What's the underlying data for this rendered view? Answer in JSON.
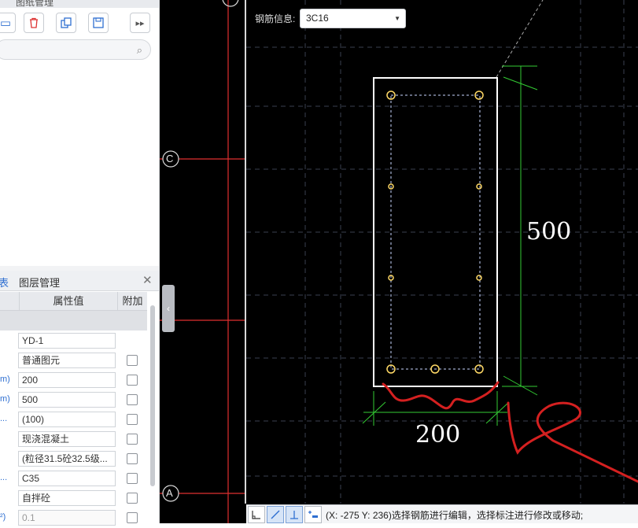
{
  "top_pane": {
    "tab_label": "图纸管理"
  },
  "toolbar": {
    "buttons": [
      {
        "name": "add-component-button",
        "icon": "monitor-icon"
      },
      {
        "name": "delete-button",
        "icon": "trash-icon"
      },
      {
        "name": "copy-button",
        "icon": "copy-icon"
      },
      {
        "name": "save-as-button",
        "icon": "save-icon"
      },
      {
        "name": "more-button",
        "icon": "double-chevron-right-icon"
      }
    ]
  },
  "search": {
    "placeholder": ""
  },
  "properties": {
    "tab_label": "表",
    "layer_tab_label": "图层管理",
    "columns": {
      "value": "属性值",
      "extra": "附加"
    },
    "rows": [
      {
        "key": "",
        "value": "YD-1",
        "has_checkbox": false
      },
      {
        "key": "",
        "value": "普通图元",
        "has_checkbox": true
      },
      {
        "key": "m)",
        "value": "200",
        "has_checkbox": true
      },
      {
        "key": "m)",
        "value": "500",
        "has_checkbox": true
      },
      {
        "key": "...",
        "value": "(100)",
        "has_checkbox": true
      },
      {
        "key": "",
        "value": "现浇混凝土",
        "has_checkbox": true
      },
      {
        "key": "",
        "value": "(粒径31.5砼32.5级...",
        "has_checkbox": true
      },
      {
        "key": "...",
        "value": "C35",
        "has_checkbox": true
      },
      {
        "key": "",
        "value": "自拌砼",
        "has_checkbox": true
      },
      {
        "key": "²)",
        "value": "0.1",
        "has_checkbox": true
      }
    ]
  },
  "canvas": {
    "rebar_info_label": "钢筋信息:",
    "rebar_info_value": "3C16",
    "axis_labels": {
      "c": "C",
      "a": "A"
    },
    "dimensions": {
      "height": "500",
      "width": "200"
    },
    "colors": {
      "background": "#000000",
      "axis": "#ff3333",
      "section": "#ffffff",
      "rebar": "#ffd966",
      "dimension": "#33cc33",
      "annotation": "#d42020"
    }
  },
  "statusbar": {
    "text": "(X: -275 Y: 236)选择钢筋进行编辑，选择标注进行修改或移动;",
    "buttons": [
      {
        "name": "orthogonal-button",
        "icon": "ortho-icon"
      },
      {
        "name": "slope-button",
        "icon": "slope-icon"
      },
      {
        "name": "perpendicular-button",
        "icon": "perpendicular-icon"
      },
      {
        "name": "dynamic-input-button",
        "icon": "dynamic-input-icon"
      }
    ]
  }
}
